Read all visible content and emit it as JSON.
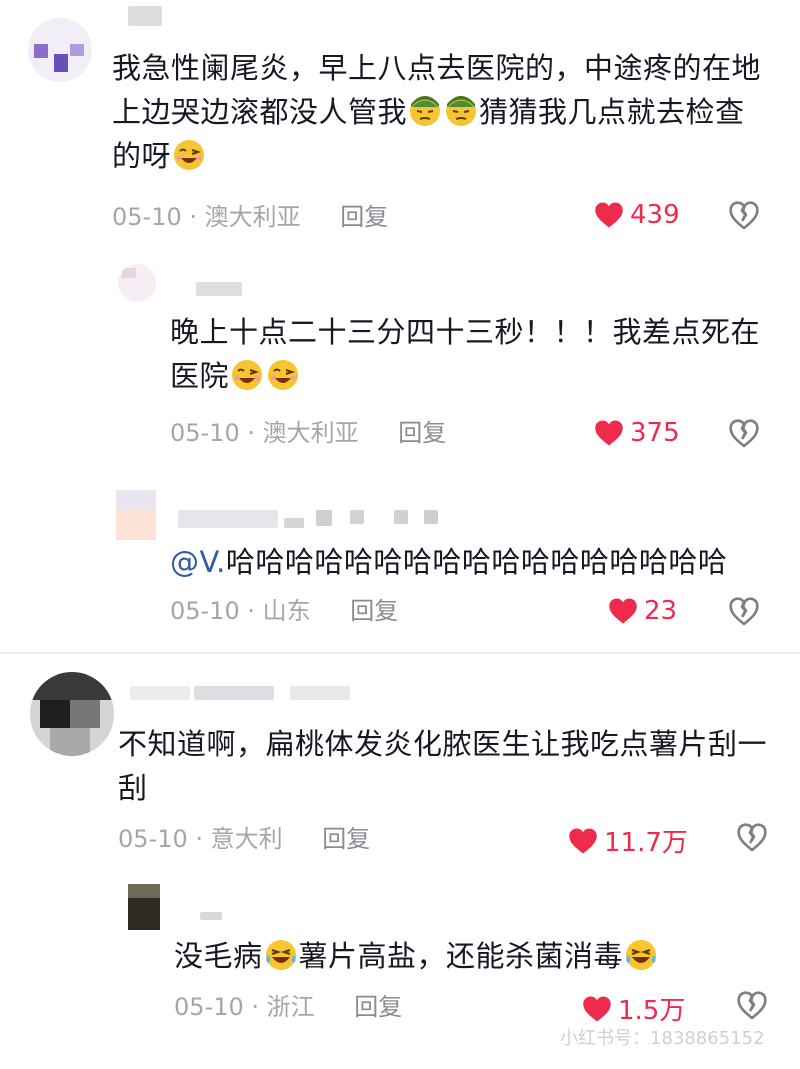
{
  "comments": [
    {
      "text_before": "我急性阑尾炎，早上八点去医院的，中途疼的在地上边哭边滚都没人管我",
      "text_mid": "猜猜我几点就去检查的呀",
      "date": "05-10",
      "location": "澳大利亚",
      "reply_label": "回复",
      "likes": "439"
    },
    {
      "text_before": "晚上十点二十三分四十三秒！！！我差点死在医院",
      "date": "05-10",
      "location": "澳大利亚",
      "reply_label": "回复",
      "likes": "375"
    },
    {
      "mention": "@V.",
      "text_after": "哈哈哈哈哈哈哈哈哈哈哈哈哈哈哈哈哈",
      "date": "05-10",
      "location": "山东",
      "reply_label": "回复",
      "likes": "23"
    },
    {
      "text_before": "不知道啊，扁桃体发炎化脓医生让我吃点薯片刮一刮",
      "date": "05-10",
      "location": "意大利",
      "reply_label": "回复",
      "likes": "11.7万"
    },
    {
      "text_before": "没毛病",
      "text_mid": "薯片高盐，还能杀菌消毒",
      "date": "05-10",
      "location": "浙江",
      "reply_label": "回复",
      "likes": "1.5万"
    }
  ],
  "watermark": "小红书号：1838865152",
  "colors": {
    "like": "#ee2b4d",
    "meta": "#a5a6ab",
    "mention": "#2f5aa8"
  },
  "icons": [
    "heart-filled-icon",
    "broken-heart-icon",
    "smirk-face-emoji",
    "wink-face-emoji",
    "laughing-tears-emoji"
  ]
}
